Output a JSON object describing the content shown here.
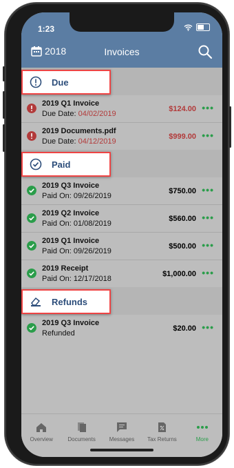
{
  "status": {
    "time": "1:23"
  },
  "appbar": {
    "year": "2018",
    "title": "Invoices"
  },
  "sections": {
    "due": {
      "label": "Due"
    },
    "paid": {
      "label": "Paid"
    },
    "refunds": {
      "label": "Refunds"
    }
  },
  "due_items": [
    {
      "name": "2019 Q1 Invoice",
      "sub_label": "Due Date:",
      "sub_value": "04/02/2019",
      "amount": "$124.00"
    },
    {
      "name": "2019 Documents.pdf",
      "sub_label": "Due Date:",
      "sub_value": "04/12/2019",
      "amount": "$999.00"
    }
  ],
  "paid_items": [
    {
      "name": "2019 Q3 Invoice",
      "sub": "Paid On: 09/26/2019",
      "amount": "$750.00"
    },
    {
      "name": "2019 Q2 Invoice",
      "sub": "Paid On: 01/08/2019",
      "amount": "$560.00"
    },
    {
      "name": "2019 Q1 Invoice",
      "sub": "Paid On: 09/26/2019",
      "amount": "$500.00"
    },
    {
      "name": "2019 Receipt",
      "sub": "Paid On: 12/17/2018",
      "amount": "$1,000.00"
    }
  ],
  "refund_items": [
    {
      "name": "2019 Q3 Invoice",
      "sub": "Refunded",
      "amount": "$20.00"
    }
  ],
  "more_glyph": "•••",
  "tabs": [
    {
      "label": "Overview",
      "icon": "home-icon"
    },
    {
      "label": "Documents",
      "icon": "documents-icon"
    },
    {
      "label": "Messages",
      "icon": "messages-icon"
    },
    {
      "label": "Tax Returns",
      "icon": "tax-returns-icon"
    },
    {
      "label": "More",
      "icon": "more-icon"
    }
  ],
  "colors": {
    "header": "#5b7da3",
    "due": "#b23a3a",
    "paid": "#2a9d4a",
    "accent_border": "#e44"
  }
}
